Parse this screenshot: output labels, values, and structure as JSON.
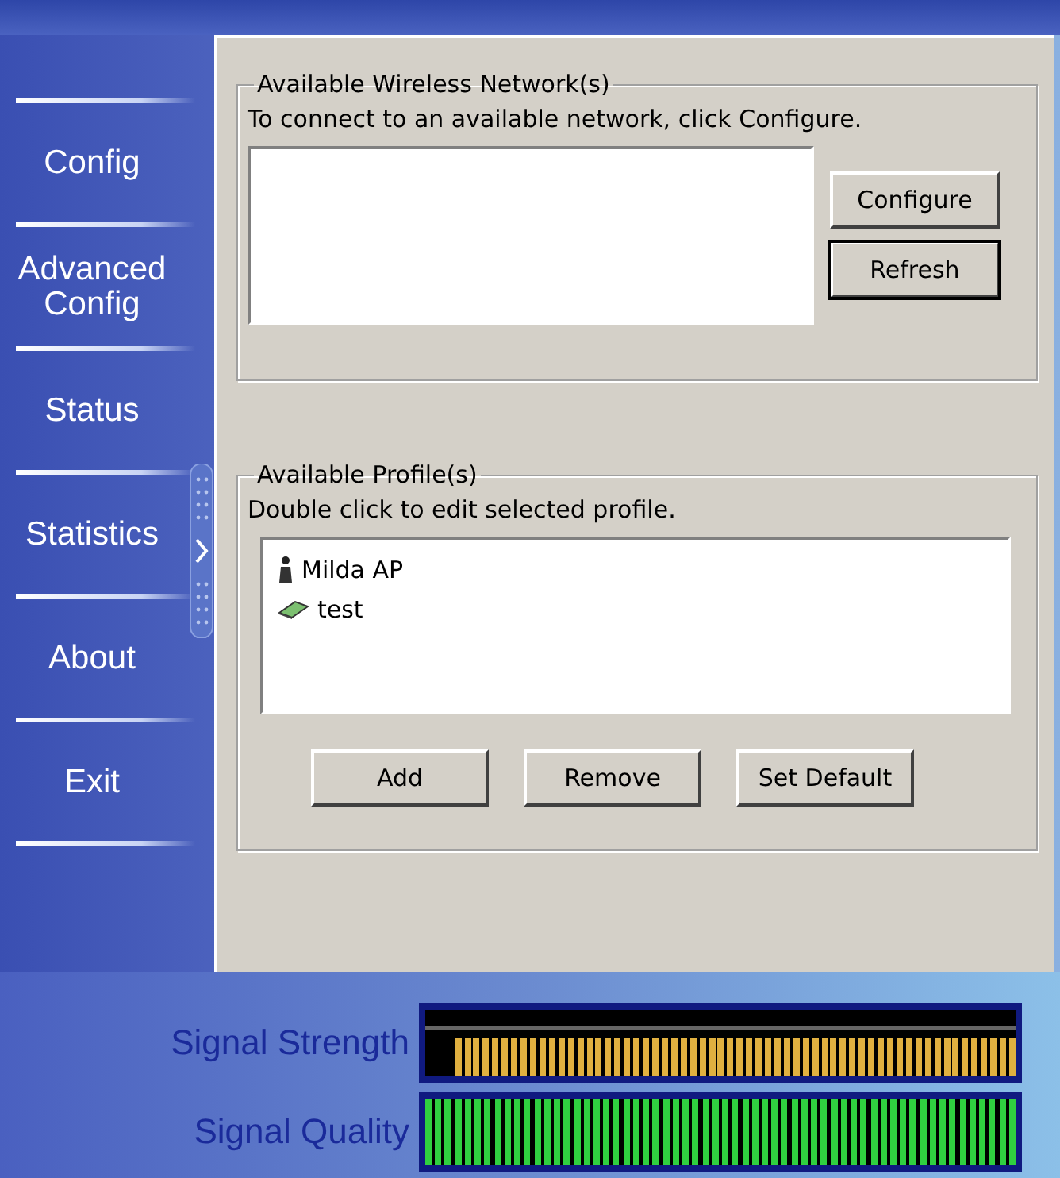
{
  "sidebar": {
    "items": [
      {
        "label": "Config"
      },
      {
        "label": "Advanced Config"
      },
      {
        "label": "Status"
      },
      {
        "label": "Statistics"
      },
      {
        "label": "About"
      },
      {
        "label": "Exit"
      }
    ]
  },
  "networks": {
    "title": "Available Wireless Network(s)",
    "hint": "To connect to an available network, click Configure.",
    "buttons": [
      {
        "label": "Configure",
        "focused": false
      },
      {
        "label": "Refresh",
        "focused": true
      }
    ]
  },
  "profiles": {
    "title": "Available Profile(s)",
    "hint": "Double click to edit selected profile.",
    "items": [
      {
        "name": "Milda AP",
        "kind": "access-point"
      },
      {
        "name": "test",
        "kind": "adhoc"
      }
    ],
    "buttons": [
      {
        "label": "Add"
      },
      {
        "label": "Remove"
      },
      {
        "label": "Set Default"
      }
    ]
  },
  "meters": [
    {
      "label": "Signal Strength",
      "kind": "strength",
      "level": 0.95
    },
    {
      "label": "Signal Quality",
      "kind": "quality",
      "level": 1
    }
  ]
}
